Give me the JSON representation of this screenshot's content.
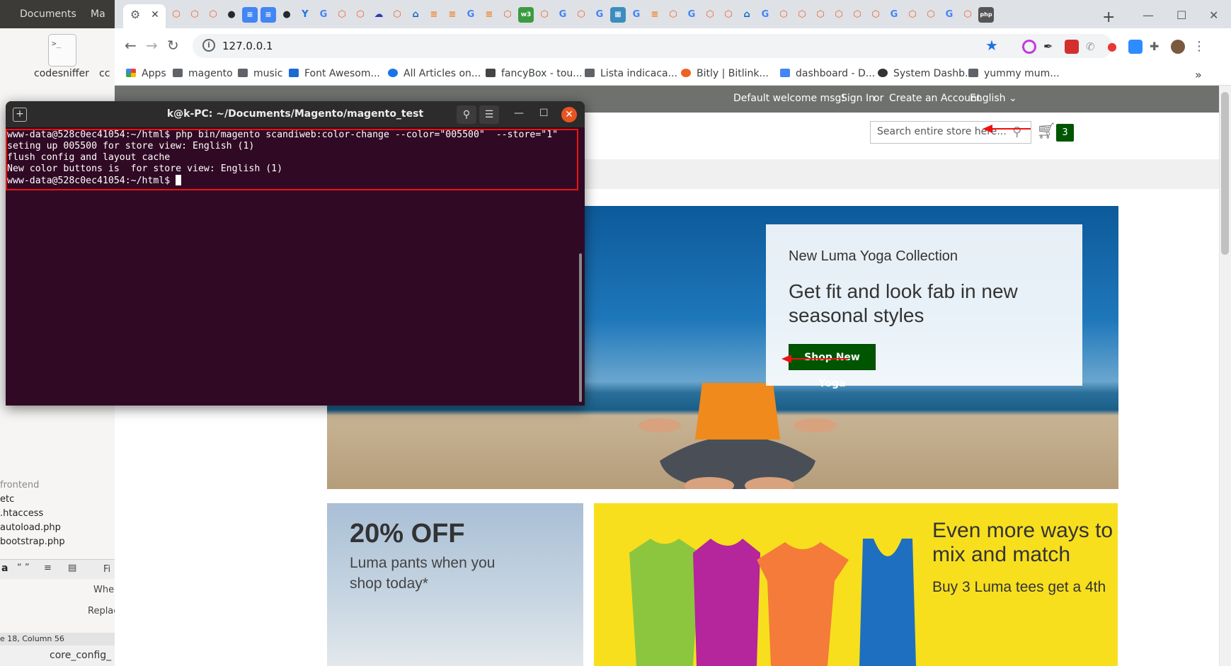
{
  "background_app": {
    "tabs": [
      "Documents",
      "Ma"
    ],
    "file_tile_glyph": ">_",
    "file_tile_label": "codesniffer",
    "file_tile_label_cut": "cc",
    "list_items": [
      "frontend",
      "etc",
      ".htaccess",
      "autoload.php",
      "bootstrap.php"
    ],
    "toolbar_labels": [
      "a",
      "“ ”",
      "Fi"
    ],
    "side_labels": [
      "Whe",
      "Replac"
    ],
    "status": "e 18, Column 56",
    "bottom_label": "core_config_"
  },
  "browser": {
    "url": "127.0.0.1",
    "new_tab": "+",
    "bookmarks": [
      {
        "label": "Apps",
        "icon_color": "#ea4335"
      },
      {
        "label": "magento",
        "icon_color": "#5f6368"
      },
      {
        "label": "music",
        "icon_color": "#5f6368"
      },
      {
        "label": "Font Awesom...",
        "icon_color": "#1c69d3"
      },
      {
        "label": "All Articles on...",
        "icon_color": "#1a73e8"
      },
      {
        "label": "fancyBox - tou...",
        "icon_color": "#444444"
      },
      {
        "label": "Lista indicaca...",
        "icon_color": "#5f6368"
      },
      {
        "label": "Bitly | Bitlink...",
        "icon_color": "#ee6123"
      },
      {
        "label": "dashboard - D...",
        "icon_color": "#4285f4"
      },
      {
        "label": "System Dashb...",
        "icon_color": "#333333"
      },
      {
        "label": "yummy mum...",
        "icon_color": "#5f6368"
      }
    ],
    "bookmarks_overflow": "»"
  },
  "store": {
    "header_links": {
      "welcome": "Default welcome msg!",
      "sign_in": "Sign In",
      "or": "or",
      "create_account": "Create an Account",
      "language": "English ⌄"
    },
    "search_placeholder": "Search entire store here...",
    "cart_count": "3",
    "hero": {
      "subtitle": "New Luma Yoga Collection",
      "title": "Get fit and look fab in new seasonal styles",
      "button": "Shop New Yoga"
    },
    "promo_left": {
      "title": "20% OFF",
      "text": "Luma pants when you shop today*"
    },
    "promo_right": {
      "title": "Even more ways to mix and match",
      "text": "Buy 3 Luma tees get a 4th"
    }
  },
  "terminal": {
    "title": "k@k-PC: ~/Documents/Magento/magento_test",
    "lines": [
      "www-data@528c0ec41054:~/html$ php bin/magento scandiweb:color-change --color=\"005500\"  --store=\"1\"",
      "seting up 005500 for store view: English (1)",
      "flush config and layout cache",
      "New color buttons is  for store view: English (1)",
      "www-data@528c0ec41054:~/html$ "
    ]
  },
  "colors": {
    "button_green": "#005500",
    "terminal_bg": "#300a24",
    "annotation_red": "#e11111"
  }
}
